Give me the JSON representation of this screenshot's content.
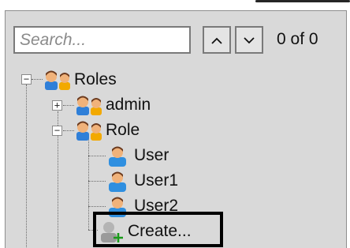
{
  "search": {
    "placeholder": "Search...",
    "value": ""
  },
  "navigation": {
    "match_count": "0 of 0"
  },
  "tree": {
    "root": {
      "label": "Roles",
      "icon": "roles-group-icon",
      "expanded": true
    },
    "children": [
      {
        "label": "admin",
        "icon": "role-icon",
        "expanded": false
      },
      {
        "label": "Role",
        "icon": "role-icon",
        "expanded": true,
        "users": [
          {
            "label": "User",
            "icon": "user-icon"
          },
          {
            "label": "User1",
            "icon": "user-icon"
          },
          {
            "label": "User2",
            "icon": "user-icon"
          }
        ],
        "create": {
          "label": "Create...",
          "icon": "create-user-icon"
        }
      }
    ]
  },
  "colors": {
    "panel_bg": "#d9d9d9",
    "highlight_border": "#000000",
    "plus_green": "#1a9a1a"
  }
}
